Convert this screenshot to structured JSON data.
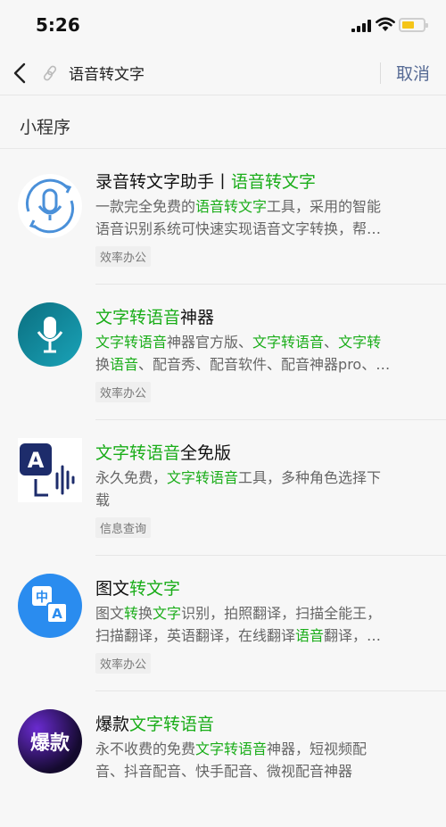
{
  "status_bar": {
    "time": "5:26"
  },
  "search": {
    "query": "语音转文字",
    "cancel_label": "取消"
  },
  "section_title": "小程序",
  "results": [
    {
      "title": [
        {
          "t": "录音转文字助手丨"
        },
        {
          "t": "语音转文字",
          "hl": true
        }
      ],
      "desc_lines": [
        [
          {
            "t": "一款完全免费的"
          },
          {
            "t": "语音转文字",
            "hl": true
          },
          {
            "t": "工具，采用的智能"
          }
        ],
        [
          {
            "t": "语音识别系统可快速实现语音文字转换，帮…"
          }
        ]
      ],
      "tag": "效率办公",
      "icon": "microphone-refresh-icon"
    },
    {
      "title": [
        {
          "t": "文字转语音",
          "hl": true
        },
        {
          "t": "神器"
        }
      ],
      "desc_lines": [
        [
          {
            "t": "文字转语音",
            "hl": true
          },
          {
            "t": "神器官方版、"
          },
          {
            "t": "文字转语音",
            "hl": true
          },
          {
            "t": "、"
          },
          {
            "t": "文字转",
            "hl": true
          }
        ],
        [
          {
            "t": "换"
          },
          {
            "t": "语音",
            "hl": true
          },
          {
            "t": "、配音秀、配音软件、配音神器pro、…"
          }
        ]
      ],
      "tag": "效率办公",
      "icon": "microphone-icon"
    },
    {
      "title": [
        {
          "t": "文字转语音",
          "hl": true
        },
        {
          "t": "全免版"
        }
      ],
      "desc_lines": [
        [
          {
            "t": "永久免费，"
          },
          {
            "t": "文字转语音",
            "hl": true
          },
          {
            "t": "工具，多种角色选择下"
          }
        ],
        [
          {
            "t": "载"
          }
        ]
      ],
      "tag": "信息查询",
      "icon": "text-to-audio-icon"
    },
    {
      "title": [
        {
          "t": "图文"
        },
        {
          "t": "转文字",
          "hl": true
        }
      ],
      "desc_lines": [
        [
          {
            "t": "图文"
          },
          {
            "t": "转",
            "hl": true
          },
          {
            "t": "换"
          },
          {
            "t": "文字",
            "hl": true
          },
          {
            "t": "识别，拍照翻译，扫描全能王，"
          }
        ],
        [
          {
            "t": "扫描翻译，英语翻译，在线翻译"
          },
          {
            "t": "语音",
            "hl": true
          },
          {
            "t": "翻译，…"
          }
        ]
      ],
      "tag": "效率办公",
      "icon": "translate-icon"
    },
    {
      "title": [
        {
          "t": "爆款"
        },
        {
          "t": "文字转语音",
          "hl": true
        }
      ],
      "desc_lines": [
        [
          {
            "t": "永不收费的免费"
          },
          {
            "t": "文字转语音",
            "hl": true
          },
          {
            "t": "神器，短视频配"
          }
        ],
        [
          {
            "t": "音、抖音配音、快手配音、微视配音神器"
          }
        ]
      ],
      "tag": "",
      "icon": "baokuan-logo-icon",
      "icon_text": "爆款"
    }
  ]
}
